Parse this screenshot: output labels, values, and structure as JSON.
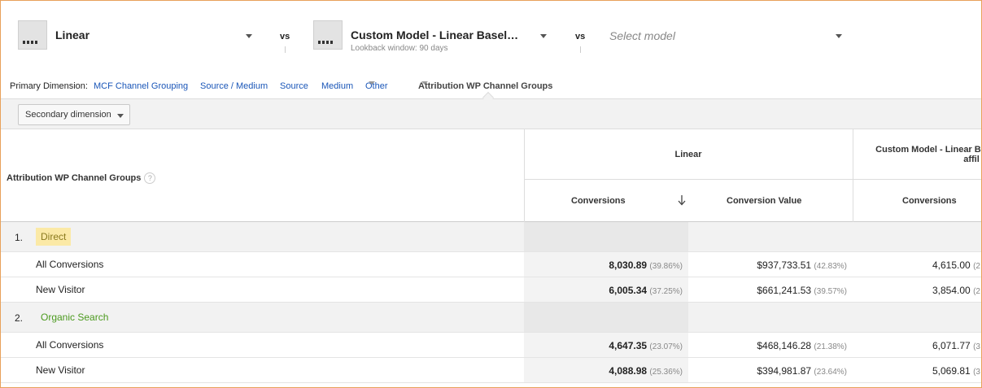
{
  "colors": {
    "frame_border": "#e8a15a",
    "link": "#1a56b8",
    "direct_bg": "#fbe9a6",
    "direct_text": "#8a7a1e",
    "organic_text": "#4b9a1e",
    "sorted_column": "#f3f3f3"
  },
  "models": {
    "first": {
      "name": "Linear",
      "icon": "model-icon"
    },
    "vs1": "vs",
    "second": {
      "name": "Custom Model - Linear Basel…",
      "subtitle": "Lookback window: 90 days",
      "icon": "model-icon"
    },
    "vs2": "vs",
    "third": {
      "placeholder": "Select model"
    }
  },
  "primary_dimension": {
    "label": "Primary Dimension:",
    "links": [
      "MCF Channel Grouping",
      "Source / Medium",
      "Source",
      "Medium",
      "Other"
    ],
    "active": "Attribution WP Channel Groups"
  },
  "toolbar": {
    "secondary_dimension": "Secondary dimension"
  },
  "table": {
    "dimension_header": "Attribution WP Channel Groups",
    "help_icon": "?",
    "group1_header": "Linear",
    "group2_header_line1": "Custom Model - Linear Ba",
    "group2_header_line2": "affil",
    "metrics": [
      "Conversions",
      "Conversion Value",
      "Conversions"
    ],
    "sort_icon": "arrow-down-icon",
    "groups": [
      {
        "num": "1.",
        "name": "Direct",
        "rows": [
          {
            "label": "All Conversions",
            "conv": "8,030.89",
            "conv_pct": "(39.86%)",
            "value": "$937,733.51",
            "value_pct": "(42.83%)",
            "conv2": "4,615.00",
            "conv2_pct": "(2"
          },
          {
            "label": "New Visitor",
            "conv": "6,005.34",
            "conv_pct": "(37.25%)",
            "value": "$661,241.53",
            "value_pct": "(39.57%)",
            "conv2": "3,854.00",
            "conv2_pct": "(2"
          }
        ]
      },
      {
        "num": "2.",
        "name": "Organic Search",
        "rows": [
          {
            "label": "All Conversions",
            "conv": "4,647.35",
            "conv_pct": "(23.07%)",
            "value": "$468,146.28",
            "value_pct": "(21.38%)",
            "conv2": "6,071.77",
            "conv2_pct": "(3"
          },
          {
            "label": "New Visitor",
            "conv": "4,088.98",
            "conv_pct": "(25.36%)",
            "value": "$394,981.87",
            "value_pct": "(23.64%)",
            "conv2": "5,069.81",
            "conv2_pct": "(3"
          }
        ]
      }
    ]
  }
}
